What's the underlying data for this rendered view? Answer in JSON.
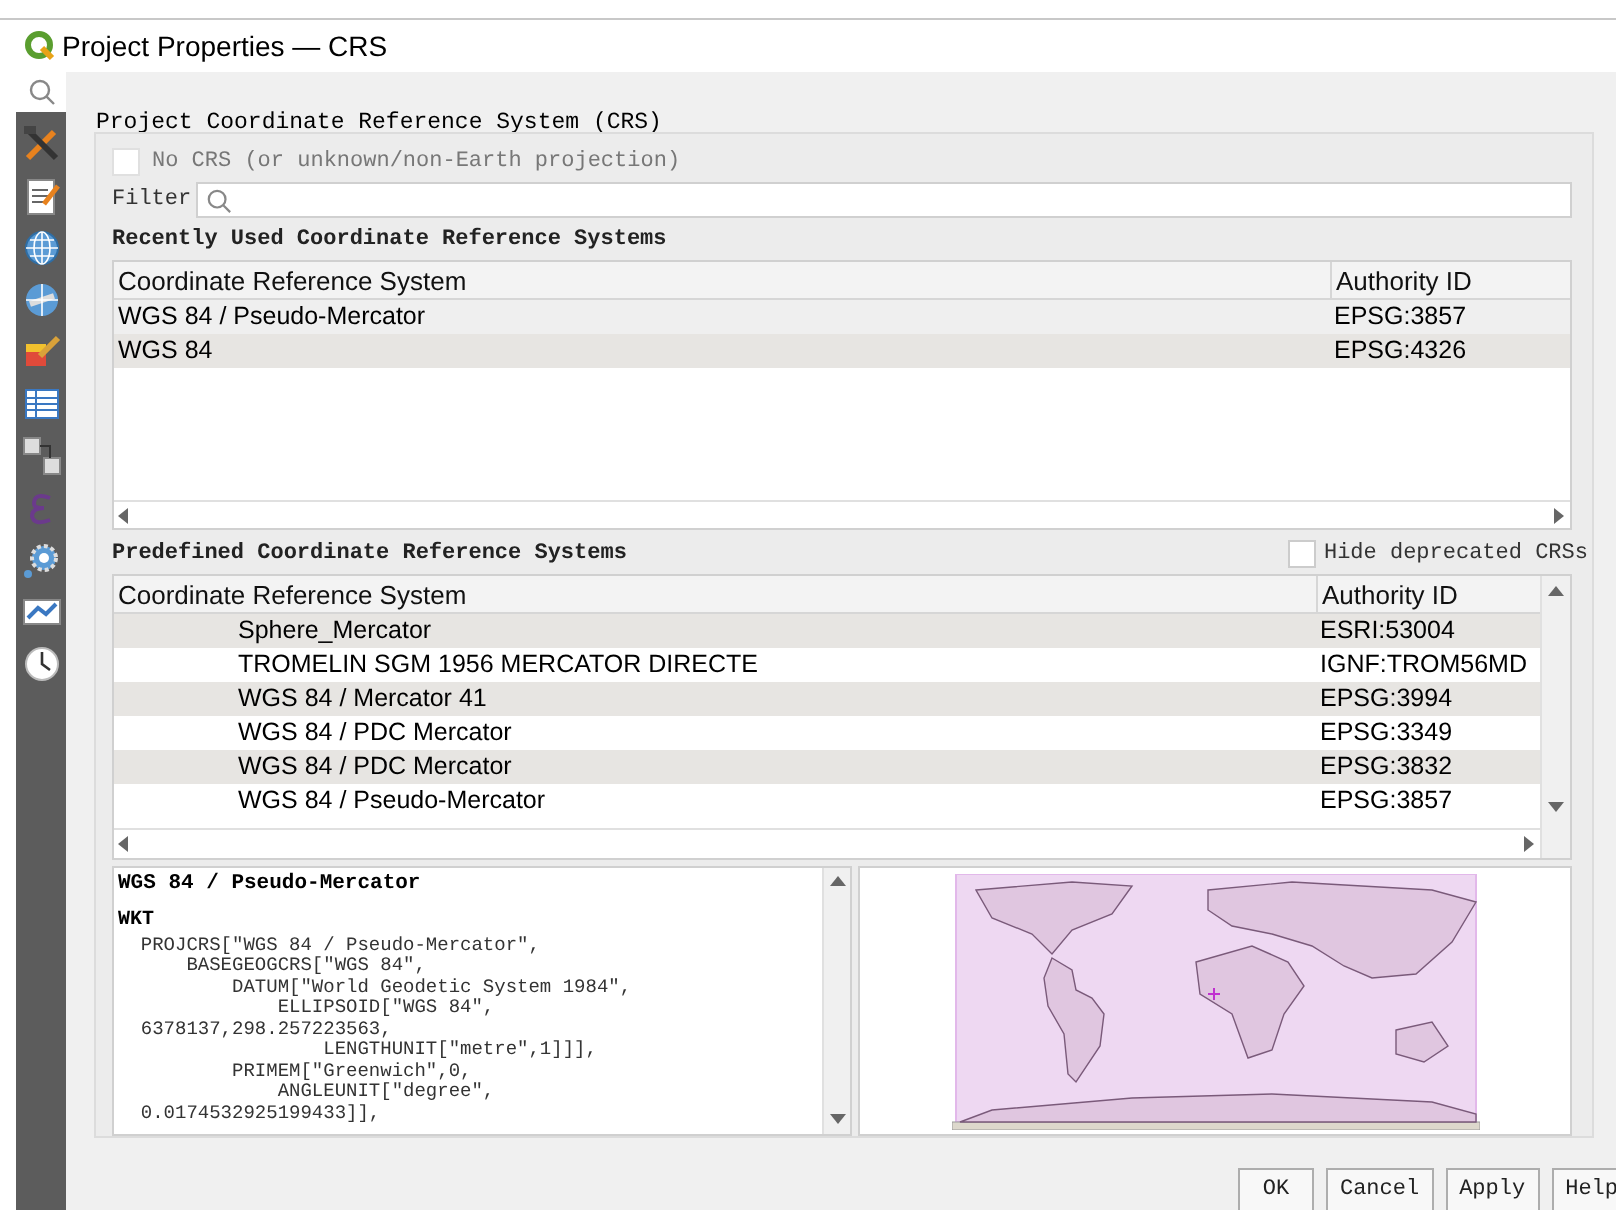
{
  "window": {
    "title": "Project Properties — CRS"
  },
  "heading": "Project Coordinate Reference System (CRS)",
  "no_crs": {
    "label": "No CRS (or unknown/non-Earth projection)",
    "checked": false,
    "disabled": true
  },
  "filter": {
    "label": "Filter"
  },
  "recent": {
    "title": "Recently Used Coordinate Reference Systems",
    "columns": [
      "Coordinate Reference System",
      "Authority ID"
    ],
    "rows": [
      {
        "name": "WGS 84 / Pseudo-Mercator",
        "id": "EPSG:3857"
      },
      {
        "name": "WGS 84",
        "id": "EPSG:4326"
      }
    ]
  },
  "predefined": {
    "title": "Predefined Coordinate Reference Systems",
    "hide_deprecated": {
      "label": "Hide deprecated CRSs",
      "checked": false
    },
    "columns": [
      "Coordinate Reference System",
      "Authority ID"
    ],
    "rows": [
      {
        "name": "Sphere_Mercator",
        "id": "ESRI:53004"
      },
      {
        "name": "TROMELIN SGM 1956 MERCATOR DIRECTE",
        "id": "IGNF:TROM56MD"
      },
      {
        "name": "WGS 84 / Mercator 41",
        "id": "EPSG:3994"
      },
      {
        "name": "WGS 84 / PDC Mercator",
        "id": "EPSG:3349"
      },
      {
        "name": "WGS 84 / PDC Mercator",
        "id": "EPSG:3832"
      },
      {
        "name": "WGS 84 / Pseudo-Mercator",
        "id": "EPSG:3857"
      }
    ]
  },
  "details": {
    "title": "WGS 84 / Pseudo-Mercator",
    "section": "WKT",
    "lines": [
      "  PROJCRS[\"WGS 84 / Pseudo-Mercator\",",
      "      BASEGEOGCRS[\"WGS 84\",",
      "          DATUM[\"World Geodetic System 1984\",",
      "              ELLIPSOID[\"WGS 84\",",
      "  6378137,298.257223563,",
      "                  LENGTHUNIT[\"metre\",1]]],",
      "          PRIMEM[\"Greenwich\",0,",
      "              ANGLEUNIT[\"degree\",",
      "  0.0174532925199433]],"
    ]
  },
  "buttons": [
    "OK",
    "Cancel",
    "Apply",
    "Help"
  ]
}
